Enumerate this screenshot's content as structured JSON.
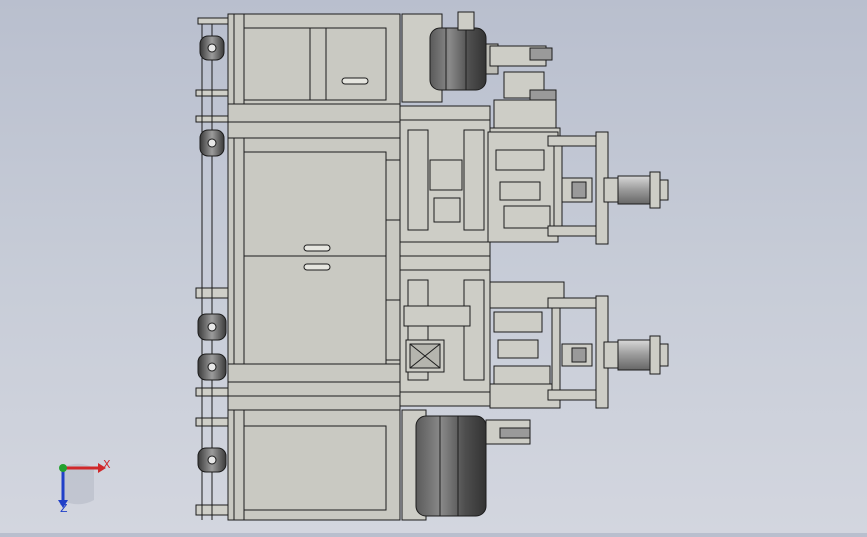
{
  "triad": {
    "x_label": "X",
    "z_label": "Z",
    "colors": {
      "x": "#d0282a",
      "y": "#23a12f",
      "z": "#2040c8"
    }
  },
  "colors": {
    "background_top": "#b9bfce",
    "background_bottom": "#d3d6df",
    "panel_fill": "#c9c9c2",
    "line": "#1c1c1c",
    "drum_dark": "#4a4a4a",
    "drum_mid": "#7a7a7a"
  }
}
